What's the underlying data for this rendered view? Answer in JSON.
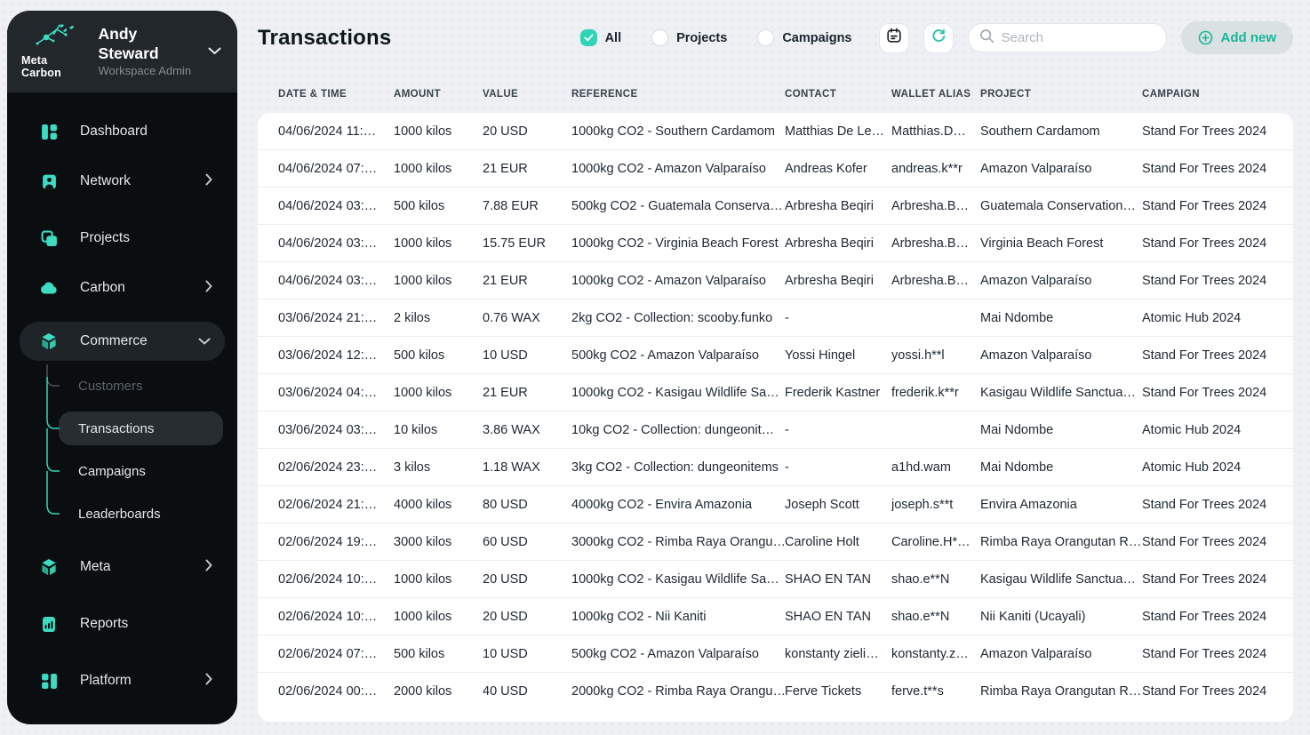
{
  "brand": {
    "logo_text": "Meta Carbon"
  },
  "user": {
    "name": "Andy Steward",
    "role": "Workspace Admin"
  },
  "colors": {
    "accent": "#2fd5b6",
    "sidebar_bg": "#0b0e11",
    "page_bg": "#eef0f3"
  },
  "sidebar": {
    "items": [
      {
        "label": "Dashboard"
      },
      {
        "label": "Network"
      },
      {
        "label": "Projects"
      },
      {
        "label": "Carbon"
      },
      {
        "label": "Commerce"
      },
      {
        "label": "Meta"
      },
      {
        "label": "Reports"
      },
      {
        "label": "Platform"
      }
    ],
    "commerce_children": [
      {
        "label": "Customers",
        "state": "dimmed"
      },
      {
        "label": "Transactions",
        "state": "active"
      },
      {
        "label": "Campaigns",
        "state": "normal"
      },
      {
        "label": "Leaderboards",
        "state": "normal"
      }
    ]
  },
  "header": {
    "title": "Transactions",
    "filters": [
      {
        "label": "All",
        "checked": true
      },
      {
        "label": "Projects",
        "checked": false
      },
      {
        "label": "Campaigns",
        "checked": false
      }
    ],
    "search": {
      "placeholder": "Search"
    },
    "add_new_label": "Add new",
    "icons": [
      "calendar-icon",
      "refresh-icon",
      "search-icon",
      "plus-circle-icon"
    ]
  },
  "table": {
    "columns": [
      "DATE & TIME",
      "AMOUNT",
      "VALUE",
      "REFERENCE",
      "CONTACT",
      "WALLET ALIAS",
      "PROJECT",
      "CAMPAIGN"
    ],
    "rows": [
      [
        "04/06/2024 11:…",
        "1000 kilos",
        "20 USD",
        "1000kg CO2 - Southern Cardamom",
        "Matthias De Le…",
        "Matthias.D…",
        "Southern Cardamom",
        "Stand For Trees 2024"
      ],
      [
        "04/06/2024 07:…",
        "1000 kilos",
        "21 EUR",
        "1000kg CO2 - Amazon Valparaíso",
        "Andreas Kofer",
        "andreas.k**r",
        "Amazon Valparaíso",
        "Stand For Trees 2024"
      ],
      [
        "04/06/2024 03:…",
        "500 kilos",
        "7.88 EUR",
        "500kg CO2 - Guatemala Conserva…",
        "Arbresha Beqiri",
        "Arbresha.B…",
        "Guatemala Conservation…",
        "Stand For Trees 2024"
      ],
      [
        "04/06/2024 03:…",
        "1000 kilos",
        "15.75 EUR",
        "1000kg CO2 - Virginia Beach Forest",
        "Arbresha Beqiri",
        "Arbresha.B…",
        "Virginia Beach Forest",
        "Stand For Trees 2024"
      ],
      [
        "04/06/2024 03:…",
        "1000 kilos",
        "21 EUR",
        "1000kg CO2 - Amazon Valparaíso",
        "Arbresha Beqiri",
        "Arbresha.B…",
        "Amazon Valparaíso",
        "Stand For Trees 2024"
      ],
      [
        "03/06/2024 21:…",
        "2 kilos",
        "0.76 WAX",
        "2kg CO2 - Collection: scooby.funko",
        "-",
        "",
        "Mai Ndombe",
        "Atomic Hub 2024"
      ],
      [
        "03/06/2024 12:…",
        "500 kilos",
        "10 USD",
        "500kg CO2 - Amazon Valparaíso",
        "Yossi Hingel",
        "yossi.h**l",
        "Amazon Valparaíso",
        "Stand For Trees 2024"
      ],
      [
        "03/06/2024 04:…",
        "1000 kilos",
        "21 EUR",
        "1000kg CO2 - Kasigau Wildlife Sa…",
        "Frederik Kastner",
        "frederik.k**r",
        "Kasigau Wildlife Sanctua…",
        "Stand For Trees 2024"
      ],
      [
        "03/06/2024 03:…",
        "10 kilos",
        "3.86 WAX",
        "10kg CO2 - Collection: dungeonit…",
        "-",
        "",
        "Mai Ndombe",
        "Atomic Hub 2024"
      ],
      [
        "02/06/2024 23:…",
        "3 kilos",
        "1.18 WAX",
        "3kg CO2 - Collection: dungeonitems",
        "-",
        "a1hd.wam",
        "Mai Ndombe",
        "Atomic Hub 2024"
      ],
      [
        "02/06/2024 21:…",
        "4000 kilos",
        "80 USD",
        "4000kg CO2 - Envira Amazonia",
        "Joseph Scott",
        "joseph.s**t",
        "Envira Amazonia",
        "Stand For Trees 2024"
      ],
      [
        "02/06/2024 19:…",
        "3000 kilos",
        "60 USD",
        "3000kg CO2 - Rimba Raya Orangu…",
        "Caroline Holt",
        "Caroline.H*…",
        "Rimba Raya Orangutan R…",
        "Stand For Trees 2024"
      ],
      [
        "02/06/2024 10:…",
        "1000 kilos",
        "20 USD",
        "1000kg CO2 - Kasigau Wildlife Sa…",
        "SHAO EN TAN",
        "shao.e**N",
        "Kasigau Wildlife Sanctua…",
        "Stand For Trees 2024"
      ],
      [
        "02/06/2024 10:…",
        "1000 kilos",
        "20 USD",
        "1000kg CO2 - Nii Kaniti",
        "SHAO EN TAN",
        "shao.e**N",
        "Nii Kaniti (Ucayali)",
        "Stand For Trees 2024"
      ],
      [
        "02/06/2024 07:…",
        "500 kilos",
        "10 USD",
        "500kg CO2 - Amazon Valparaíso",
        "konstanty zieli…",
        "konstanty.z…",
        "Amazon Valparaíso",
        "Stand For Trees 2024"
      ],
      [
        "02/06/2024 00:…",
        "2000 kilos",
        "40 USD",
        "2000kg CO2 - Rimba Raya Orangu…",
        "Ferve Tickets",
        "ferve.t**s",
        "Rimba Raya Orangutan R…",
        "Stand For Trees 2024"
      ]
    ]
  }
}
